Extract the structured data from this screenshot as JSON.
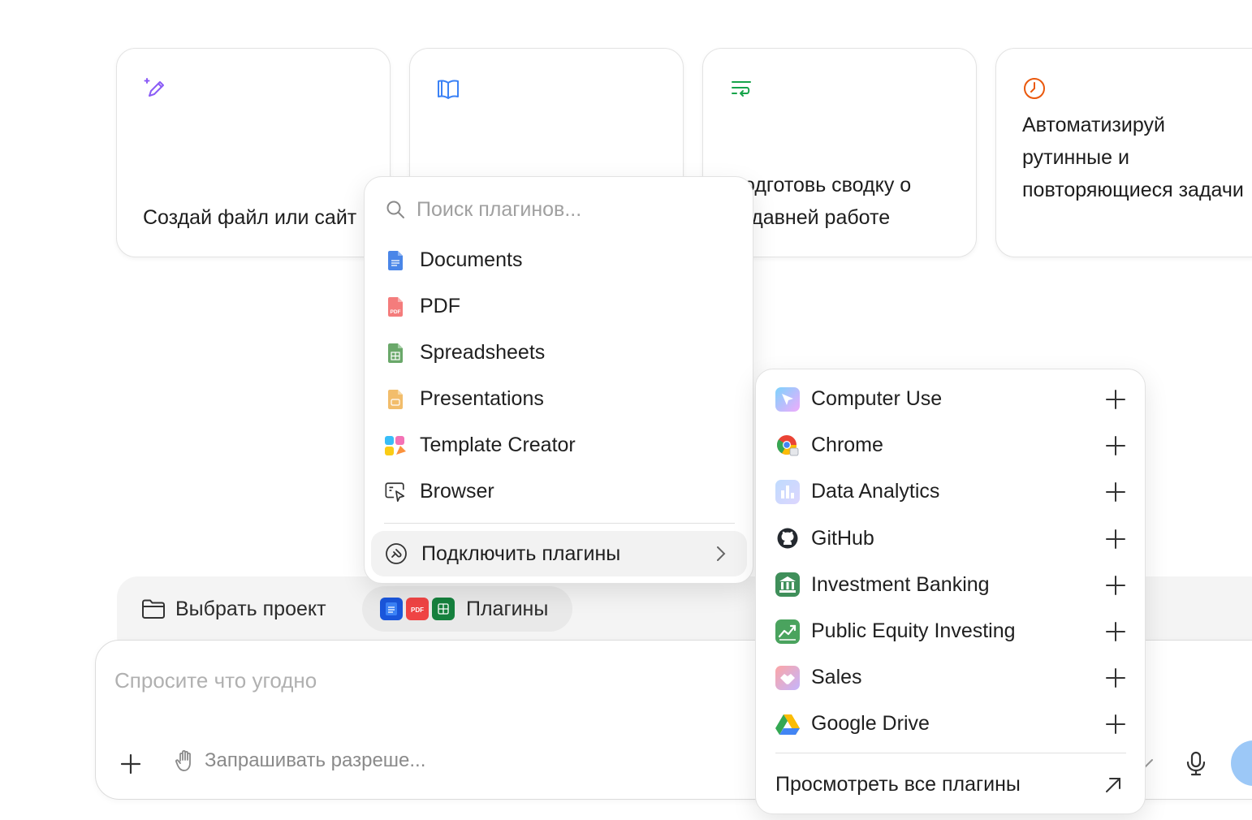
{
  "cards": [
    {
      "text": "Создай файл или сайт",
      "icon": "pencil-sparkle-icon",
      "color": "#8b5cf6"
    },
    {
      "text": "",
      "icon": "open-book-icon",
      "color": "#3b82f6"
    },
    {
      "text": "Подготовь сводку о недавней работе",
      "icon": "text-wrap-icon",
      "color": "#16a34a"
    },
    {
      "text": "Автоматизируй рутинные и повторяющиеся задачи",
      "icon": "clock-icon",
      "color": "#ea580c"
    }
  ],
  "project": {
    "label": "Выбрать проект",
    "icon": "folder-icon"
  },
  "plugins_chip": {
    "label": "Плагины"
  },
  "composer": {
    "placeholder": "Спросите что угодно",
    "permission_label": "Запрашивать разреше..."
  },
  "popover": {
    "search_placeholder": "Поиск плагинов...",
    "items": [
      {
        "label": "Documents",
        "icon": "documents-icon",
        "color": "#4a86e8"
      },
      {
        "label": "PDF",
        "icon": "pdf-icon",
        "color": "#f47c7c"
      },
      {
        "label": "Spreadsheets",
        "icon": "spreadsheets-icon",
        "color": "#5a9a5a"
      },
      {
        "label": "Presentations",
        "icon": "presentations-icon",
        "color": "#f0b868"
      },
      {
        "label": "Template Creator",
        "icon": "template-creator-icon",
        "color": "#f472b6"
      },
      {
        "label": "Browser",
        "icon": "browser-icon",
        "color": "#333333"
      }
    ],
    "connect_label": "Подключить плагины"
  },
  "submenu": {
    "items": [
      {
        "label": "Computer Use",
        "icon": "computer-use-icon"
      },
      {
        "label": "Chrome",
        "icon": "chrome-icon"
      },
      {
        "label": "Data Analytics",
        "icon": "data-analytics-icon"
      },
      {
        "label": "GitHub",
        "icon": "github-icon"
      },
      {
        "label": "Investment Banking",
        "icon": "investment-banking-icon"
      },
      {
        "label": "Public Equity Investing",
        "icon": "public-equity-icon"
      },
      {
        "label": "Sales",
        "icon": "sales-icon"
      },
      {
        "label": "Google Drive",
        "icon": "google-drive-icon"
      }
    ],
    "view_all_label": "Просмотреть все плагины"
  }
}
